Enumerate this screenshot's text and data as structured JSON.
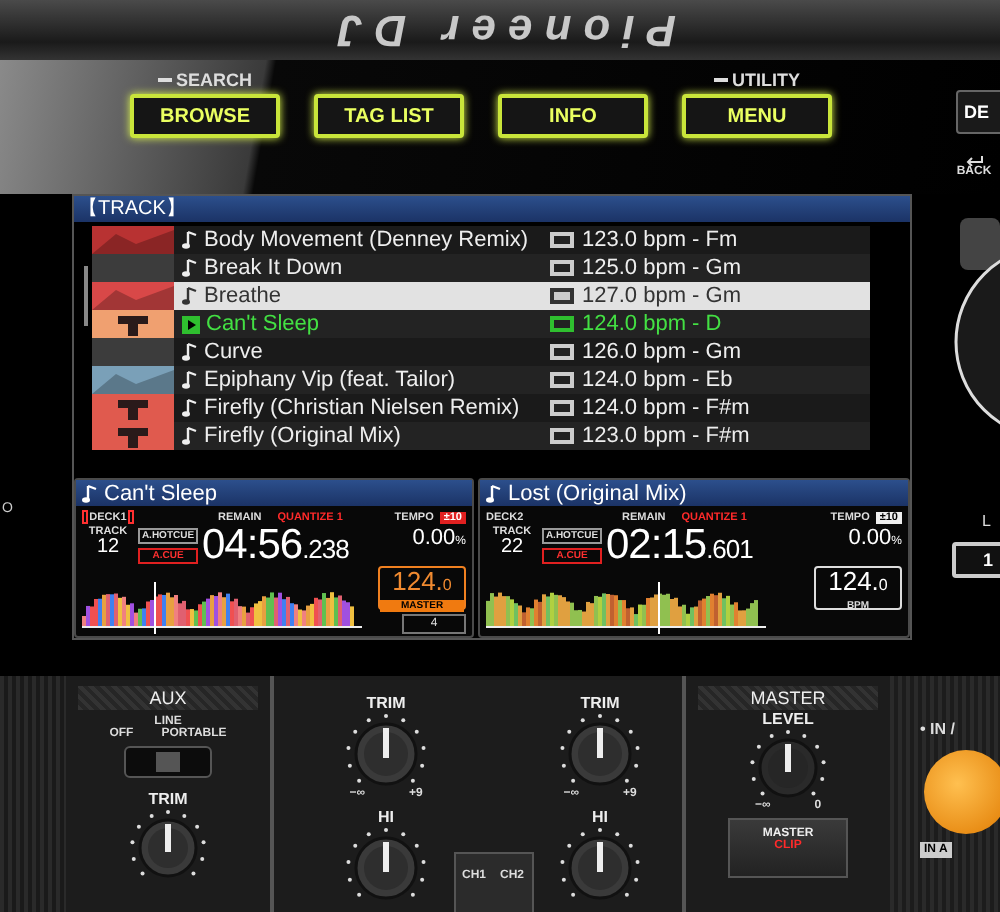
{
  "logo": "Pioneer DJ",
  "browser_buttons": [
    {
      "label": "BROWSE",
      "shift_label": "SEARCH"
    },
    {
      "label": "TAG LIST"
    },
    {
      "label": "INFO"
    },
    {
      "label": "MENU",
      "shift_label": "UTILITY"
    }
  ],
  "deck_button": "DE",
  "back_label": "BACK",
  "edge_label": "O",
  "screen": {
    "header": "【TRACK】",
    "tracks": [
      {
        "title": "Body Movement (Denney Remix)",
        "bpm_key": "123.0 bpm - Fm",
        "selected": false,
        "loaded": false,
        "art": {
          "kind": "photo",
          "color": "#b83232"
        }
      },
      {
        "title": "Break It Down",
        "bpm_key": "125.0 bpm - Gm",
        "selected": false,
        "loaded": false,
        "art": {
          "kind": "plain",
          "color": "#3c3c3c"
        }
      },
      {
        "title": "Breathe",
        "bpm_key": "127.0 bpm - Gm",
        "selected": true,
        "loaded": false,
        "art": {
          "kind": "photo",
          "color": "#d84848"
        }
      },
      {
        "title": "Can't Sleep",
        "bpm_key": "124.0 bpm - D",
        "selected": false,
        "loaded": true,
        "art": {
          "kind": "logo",
          "color": "#f0a070"
        }
      },
      {
        "title": "Curve",
        "bpm_key": "126.0 bpm - Gm",
        "selected": false,
        "loaded": false,
        "art": {
          "kind": "plain",
          "color": "#3c3c3c"
        }
      },
      {
        "title": "Epiphany Vip (feat. Tailor)",
        "bpm_key": "124.0 bpm - Eb",
        "selected": false,
        "loaded": false,
        "art": {
          "kind": "photo",
          "color": "#7aa0b8"
        }
      },
      {
        "title": "Firefly (Christian Nielsen Remix)",
        "bpm_key": "124.0 bpm - F#m",
        "selected": false,
        "loaded": false,
        "art": {
          "kind": "logo",
          "color": "#e05a4e"
        }
      },
      {
        "title": "Firefly (Original Mix)",
        "bpm_key": "123.0 bpm - F#m",
        "selected": false,
        "loaded": false,
        "art": {
          "kind": "logo",
          "color": "#e05a4e"
        }
      }
    ],
    "decks": [
      {
        "title": "Can't Sleep",
        "deck": "DECK1",
        "on_air": true,
        "master": true,
        "track_label": "TRACK",
        "track": "12",
        "hotcue": "A.HOTCUE",
        "cue": "A.CUE",
        "remain_label": "REMAIN",
        "quantize": "QUANTIZE 1",
        "time": "04:56",
        "time_ms": ".238",
        "tempo_label": "TEMPO",
        "tempo_range": "±10",
        "tempo": "0.00",
        "tempo_unit": "%",
        "bpm": "124.",
        "bpm_decimal": "0",
        "bpm_caption": "MASTER",
        "beat": "4"
      },
      {
        "title": "Lost (Original Mix)",
        "deck": "DECK2",
        "on_air": false,
        "master": false,
        "track_label": "TRACK",
        "track": "22",
        "hotcue": "A.HOTCUE",
        "cue": "A.CUE",
        "remain_label": "REMAIN",
        "quantize": "QUANTIZE 1",
        "time": "02:15",
        "time_ms": ".601",
        "tempo_label": "TEMPO",
        "tempo_range": "±10",
        "tempo": "0.00",
        "tempo_unit": "%",
        "bpm": "124.",
        "bpm_decimal": "0",
        "bpm_caption": "BPM"
      }
    ]
  },
  "loop": {
    "label": "L",
    "button": "1"
  },
  "mixer": {
    "aux": {
      "title": "AUX",
      "switch_top": "LINE",
      "switch_left": "OFF",
      "switch_right": "PORTABLE",
      "switch": {
        "level": 0.5
      },
      "trim": "TRIM"
    },
    "channels": [
      {
        "trim": "TRIM",
        "min": "−∞",
        "max": "+9",
        "eq": "HI"
      },
      {
        "trim": "TRIM",
        "min": "−∞",
        "max": "+9",
        "eq": "HI"
      }
    ],
    "cue_labels": [
      "CH1",
      "CH2"
    ],
    "master": {
      "title": "MASTER",
      "knob": "LEVEL",
      "min": "−∞",
      "max": "0",
      "button": "MASTER",
      "clip": "CLIP"
    },
    "input": {
      "label": "• IN /",
      "tag": "IN A"
    }
  }
}
